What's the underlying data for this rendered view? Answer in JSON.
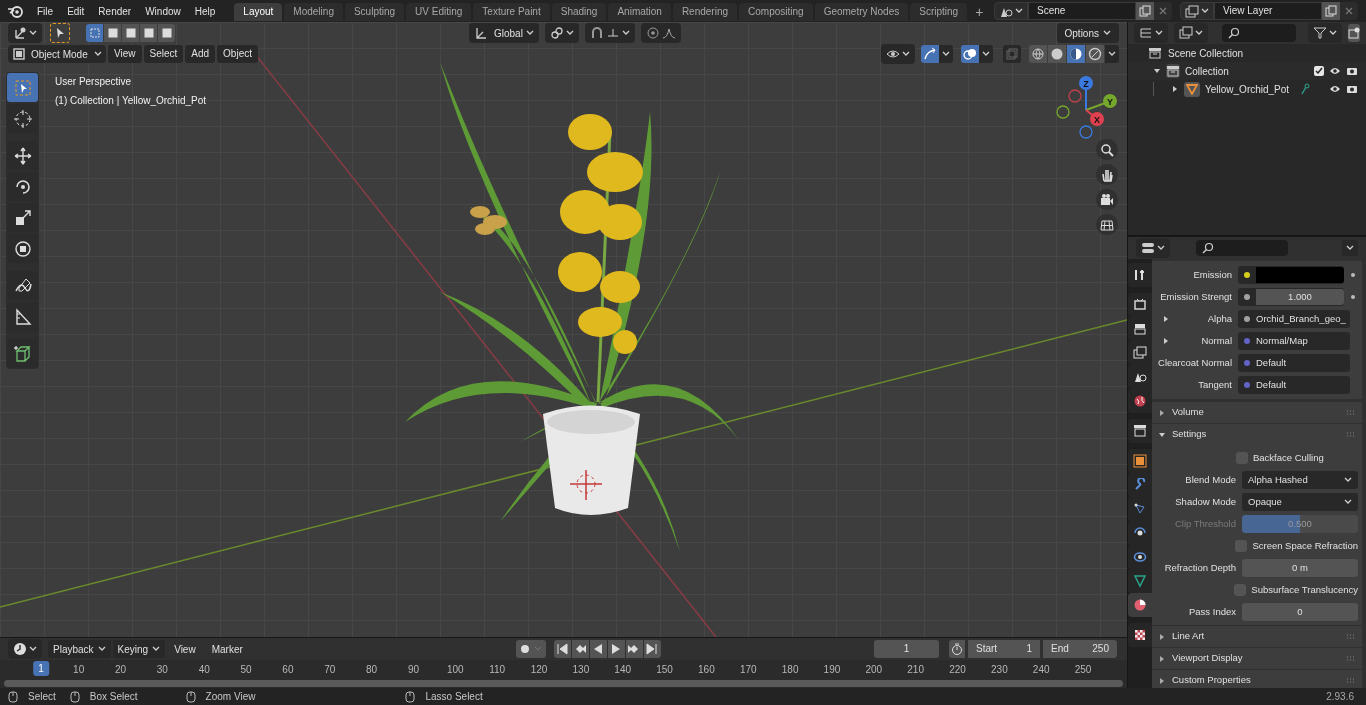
{
  "top_bar": {
    "menus": [
      "File",
      "Edit",
      "Render",
      "Window",
      "Help"
    ],
    "workspace_tabs": [
      {
        "label": "Layout",
        "selected": true
      },
      {
        "label": "Modeling",
        "selected": false
      },
      {
        "label": "Sculpting",
        "selected": false
      },
      {
        "label": "UV Editing",
        "selected": false
      },
      {
        "label": "Texture Paint",
        "selected": false
      },
      {
        "label": "Shading",
        "selected": false
      },
      {
        "label": "Animation",
        "selected": false
      },
      {
        "label": "Rendering",
        "selected": false
      },
      {
        "label": "Compositing",
        "selected": false
      },
      {
        "label": "Geometry Nodes",
        "selected": false
      },
      {
        "label": "Scripting",
        "selected": false
      }
    ],
    "add_tab": "+",
    "scene": "Scene",
    "view_layer": "View Layer"
  },
  "viewport": {
    "orientation": "Global",
    "mode": "Object Mode",
    "menus": [
      "View",
      "Select",
      "Add",
      "Object"
    ],
    "options": "Options",
    "info": [
      "User Perspective",
      "(1) Collection | Yellow_Orchid_Pot"
    ],
    "tools": [
      {
        "kind": "select",
        "selected": true
      },
      {
        "kind": "cursor",
        "selected": false
      },
      {
        "kind": "move",
        "selected": false
      },
      {
        "kind": "rotate",
        "selected": false
      },
      {
        "kind": "scale",
        "selected": false
      },
      {
        "kind": "transform",
        "selected": false
      },
      {
        "kind": "annotate",
        "selected": false
      },
      {
        "kind": "measure",
        "selected": false
      },
      {
        "kind": "add",
        "selected": false
      }
    ],
    "axes": [
      "Z",
      "Y",
      "X"
    ]
  },
  "outliner": {
    "root": "Scene Collection",
    "items": [
      {
        "label": "Collection",
        "expanded": true,
        "checked": true,
        "children": [
          {
            "label": "Yellow_Orchid_Pot",
            "expanded": false
          }
        ]
      }
    ]
  },
  "properties": {
    "tabs": [
      {
        "kind": "tool",
        "selected": false
      },
      {
        "kind": "render",
        "selected": false
      },
      {
        "kind": "output",
        "selected": false
      },
      {
        "kind": "view_layer",
        "selected": false
      },
      {
        "kind": "scene",
        "selected": false
      },
      {
        "kind": "world",
        "selected": false
      },
      {
        "kind": "collection",
        "selected": false
      },
      {
        "kind": "object",
        "selected": false
      },
      {
        "kind": "modifier",
        "selected": false
      },
      {
        "kind": "particles",
        "selected": false
      },
      {
        "kind": "physics",
        "selected": false
      },
      {
        "kind": "constraints",
        "selected": false
      },
      {
        "kind": "data",
        "selected": false
      },
      {
        "kind": "material",
        "selected": true
      },
      {
        "kind": "texture",
        "selected": false
      }
    ],
    "inputs": [
      {
        "kind": "color",
        "label": "Emission",
        "color": "#d6cf1d",
        "expandable": false
      },
      {
        "kind": "number",
        "label": "Emission Strengt",
        "value": "1.000",
        "color": "#a1a1a1",
        "expandable": false
      },
      {
        "kind": "link",
        "label": "Alpha",
        "value": "Orchid_Branch_geo_",
        "color": "#a1a1a1",
        "expandable": true
      },
      {
        "kind": "link",
        "label": "Normal",
        "value": "Normal/Map",
        "color": "#6363c7",
        "expandable": true
      },
      {
        "kind": "link",
        "label": "Clearcoat Normal",
        "value": "Default",
        "color": "#6363c7",
        "expandable": false
      },
      {
        "kind": "link",
        "label": "Tangent",
        "value": "Default",
        "color": "#6363c7",
        "expandable": false
      }
    ],
    "sections_before": [
      {
        "label": "Volume",
        "expanded": false
      },
      {
        "label": "Settings",
        "expanded": true
      }
    ],
    "settings": [
      {
        "kind": "checkbox",
        "label": "Backface Culling",
        "checked": false,
        "disabled": false
      },
      {
        "kind": "dropdown",
        "label": "Blend Mode",
        "value": "Alpha Hashed",
        "disabled": false
      },
      {
        "kind": "dropdown",
        "label": "Shadow Mode",
        "value": "Opaque",
        "disabled": false
      },
      {
        "kind": "slider",
        "label": "Clip Threshold",
        "value": "0.500",
        "level": 0.5,
        "disabled": true
      },
      {
        "kind": "checkbox",
        "label": "Screen Space Refraction",
        "checked": false,
        "disabled": false
      },
      {
        "kind": "number",
        "label": "Refraction Depth",
        "value": "0 m",
        "disabled": false
      },
      {
        "kind": "checkbox",
        "label": "Subsurface Translucency",
        "checked": false,
        "disabled": false
      },
      {
        "kind": "number",
        "label": "Pass Index",
        "value": "0",
        "disabled": false
      }
    ],
    "sections_after": [
      {
        "label": "Line Art",
        "expanded": false
      },
      {
        "label": "Viewport Display",
        "expanded": false
      },
      {
        "label": "Custom Properties",
        "expanded": false
      }
    ]
  },
  "timeline": {
    "menus": [
      "Playback",
      "Keying",
      "View",
      "Marker"
    ],
    "current_frame": "1",
    "start_label": "Start",
    "start": "1",
    "end_label": "End",
    "end": "250",
    "ruler": [
      "1",
      "10",
      "20",
      "30",
      "40",
      "50",
      "60",
      "70",
      "80",
      "90",
      "100",
      "110",
      "120",
      "130",
      "140",
      "150",
      "160",
      "170",
      "180",
      "190",
      "200",
      "210",
      "220",
      "230",
      "240",
      "250"
    ]
  },
  "status_bar": {
    "hints": [
      "Select",
      "Box Select",
      "Zoom View",
      "Lasso Select"
    ],
    "version": "2.93.6"
  }
}
